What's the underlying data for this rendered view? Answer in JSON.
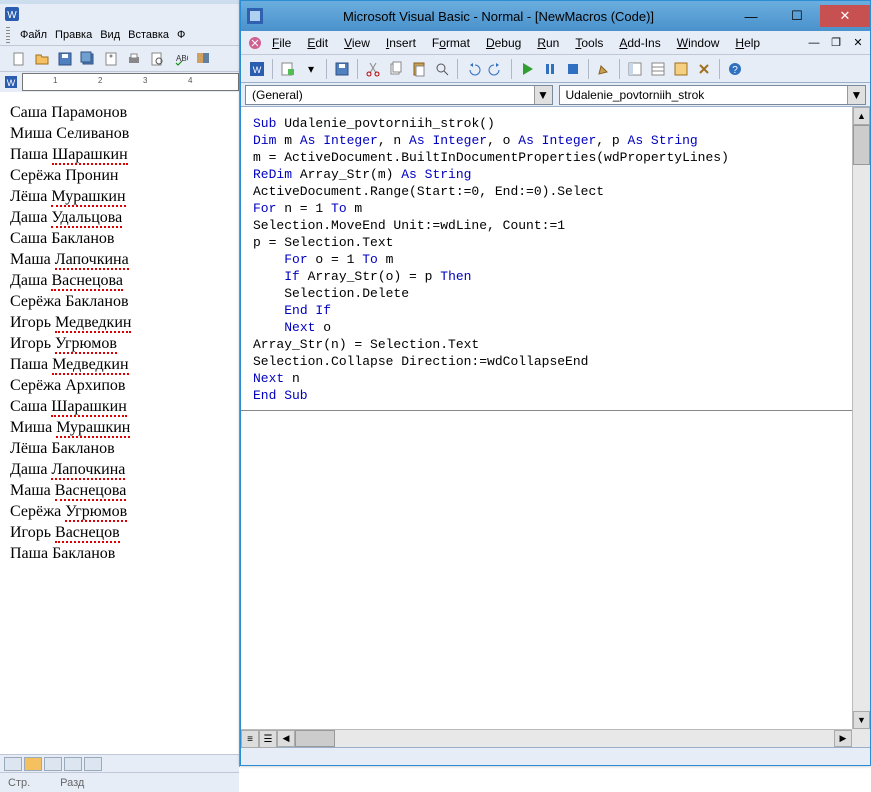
{
  "word": {
    "menu": {
      "file": "Файл",
      "edit": "Правка",
      "view": "Вид",
      "insert": "Вставка",
      "f": "Ф"
    },
    "ruler_ticks": [
      "1",
      "2",
      "3",
      "4"
    ],
    "names": [
      "Саша Парамонов",
      "Миша Селиванов",
      "Паша Шарашкин",
      "Серёжа Пронин",
      "Лёша Мурашкин",
      "Даша Удальцова",
      "Саша Бакланов",
      "Маша Лапочкина",
      "Даша Васнецова",
      "Серёжа Бакланов",
      "Игорь Медведкин",
      "Игорь Угрюмов",
      "Паша Медведкин",
      "Серёжа Архипов",
      "Саша Шарашкин",
      "Миша Мурашкин",
      "Лёша Бакланов",
      "Даша Лапочкина",
      "Маша Васнецова",
      "Серёжа Угрюмов",
      "Игорь Васнецов",
      "Паша Бакланов"
    ],
    "status": {
      "page": "Стр.",
      "section": "Разд"
    }
  },
  "vba": {
    "title": "Microsoft Visual Basic - Normal - [NewMacros (Code)]",
    "menu": {
      "file": "File",
      "edit": "Edit",
      "view": "View",
      "insert": "Insert",
      "format": "Format",
      "debug": "Debug",
      "run": "Run",
      "tools": "Tools",
      "addins": "Add-Ins",
      "window": "Window",
      "help": "Help"
    },
    "combo_left": "(General)",
    "combo_right": "Udalenie_povtorniih_strok",
    "code_lines": [
      {
        "tokens": [
          {
            "t": "Sub",
            "k": 1
          },
          {
            "t": " Udalenie_povtorniih_strok()"
          }
        ]
      },
      {
        "tokens": [
          {
            "t": "Dim",
            "k": 1
          },
          {
            "t": " m "
          },
          {
            "t": "As Integer",
            "k": 1
          },
          {
            "t": ", n "
          },
          {
            "t": "As Integer",
            "k": 1
          },
          {
            "t": ", o "
          },
          {
            "t": "As Integer",
            "k": 1
          },
          {
            "t": ", p "
          },
          {
            "t": "As String",
            "k": 1
          }
        ]
      },
      {
        "tokens": [
          {
            "t": "m = ActiveDocument.BuiltInDocumentProperties(wdPropertyLines)"
          }
        ]
      },
      {
        "tokens": [
          {
            "t": "ReDim",
            "k": 1
          },
          {
            "t": " Array_Str(m) "
          },
          {
            "t": "As String",
            "k": 1
          }
        ]
      },
      {
        "tokens": [
          {
            "t": "ActiveDocument.Range(Start:=0, End:=0).Select"
          }
        ]
      },
      {
        "tokens": [
          {
            "t": "For",
            "k": 1
          },
          {
            "t": " n = 1 "
          },
          {
            "t": "To",
            "k": 1
          },
          {
            "t": " m"
          }
        ]
      },
      {
        "tokens": [
          {
            "t": "Selection.MoveEnd Unit:=wdLine, Count:=1"
          }
        ]
      },
      {
        "tokens": [
          {
            "t": "p = Selection.Text"
          }
        ]
      },
      {
        "tokens": [
          {
            "t": "    "
          },
          {
            "t": "For",
            "k": 1
          },
          {
            "t": " o = 1 "
          },
          {
            "t": "To",
            "k": 1
          },
          {
            "t": " m"
          }
        ]
      },
      {
        "tokens": [
          {
            "t": "    "
          },
          {
            "t": "If",
            "k": 1
          },
          {
            "t": " Array_Str(o) = p "
          },
          {
            "t": "Then",
            "k": 1
          }
        ]
      },
      {
        "tokens": [
          {
            "t": "    Selection.Delete"
          }
        ]
      },
      {
        "tokens": [
          {
            "t": "    "
          },
          {
            "t": "End If",
            "k": 1
          }
        ]
      },
      {
        "tokens": [
          {
            "t": "    "
          },
          {
            "t": "Next",
            "k": 1
          },
          {
            "t": " o"
          }
        ]
      },
      {
        "tokens": [
          {
            "t": "Array_Str(n) = Selection.Text"
          }
        ]
      },
      {
        "tokens": [
          {
            "t": "Selection.Collapse Direction:=wdCollapseEnd"
          }
        ]
      },
      {
        "tokens": [
          {
            "t": "Next",
            "k": 1
          },
          {
            "t": " n"
          }
        ]
      },
      {
        "tokens": [
          {
            "t": "End Sub",
            "k": 1
          }
        ]
      }
    ]
  }
}
